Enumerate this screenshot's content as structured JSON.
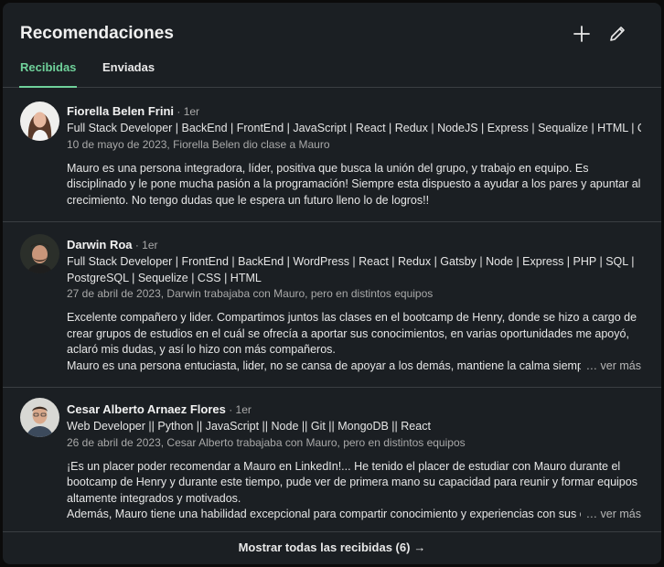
{
  "section": {
    "title": "Recomendaciones"
  },
  "icons": {
    "add": "plus-icon",
    "edit": "pencil-icon"
  },
  "tabs": [
    {
      "label": "Recibidas",
      "active": true
    },
    {
      "label": "Enviadas",
      "active": false
    }
  ],
  "recommendations": [
    {
      "name": "Fiorella Belen Frini",
      "degree": " · 1er",
      "headline": "Full Stack Developer | BackEnd | FrontEnd | JavaScript | React | Redux | NodeJS | Express | Sequalize | HTML | CSS",
      "meta": "10 de mayo de 2023, Fiorella Belen dio clase a Mauro",
      "text": "Mauro es una persona integradora, líder, positiva que busca la unión del grupo, y trabajo en equipo. Es disciplinado y le pone mucha pasión a la programación! Siempre esta dispuesto a ayudar a los pares y apuntar al crecimiento. No tengo dudas que le espera un futuro lleno lo de logros!!"
    },
    {
      "name": "Darwin Roa",
      "degree": " · 1er",
      "headline": "Full Stack Developer | FrontEnd | BackEnd | WordPress | React | Redux | Gatsby | Node | Express | PHP | SQL | PostgreSQL | Sequelize | CSS | HTML",
      "meta": "27 de abril de 2023, Darwin trabajaba con Mauro, pero en distintos equipos",
      "text": "Excelente compañero y lider. Compartimos juntos las clases en el bootcamp de Henry, donde se hizo a cargo de crear grupos de estudios en el cuál se ofrecía a aportar sus conocimientos, en varias oportunidades me apoyó, aclaró mis dudas, y así lo hizo con más compañeros.",
      "text_last": "Mauro es una persona entuciasta, lider, no se cansa de apoyar a los demás, mantiene la calma siempre",
      "more": "… ver más"
    },
    {
      "name": "Cesar Alberto Arnaez Flores",
      "degree": " · 1er",
      "headline": "Web Developer || Python || JavaScript || Node || Git || MongoDB || React",
      "meta": "26 de abril de 2023, Cesar Alberto trabajaba con Mauro, pero en distintos equipos",
      "text": "¡Es un placer poder recomendar a Mauro en LinkedIn!... He tenido el placer de estudiar con Mauro durante el bootcamp de Henry y durante este tiempo, pude ver de primera mano su capacidad para reunir y formar equipos altamente integrados y motivados.",
      "text_last": "Además, Mauro tiene una habilidad excepcional para compartir conocimiento y experiencias con sus c",
      "more": "… ver más"
    }
  ],
  "footer": {
    "label": "Mostrar todas las recibidas (6)",
    "arrow": "→"
  }
}
